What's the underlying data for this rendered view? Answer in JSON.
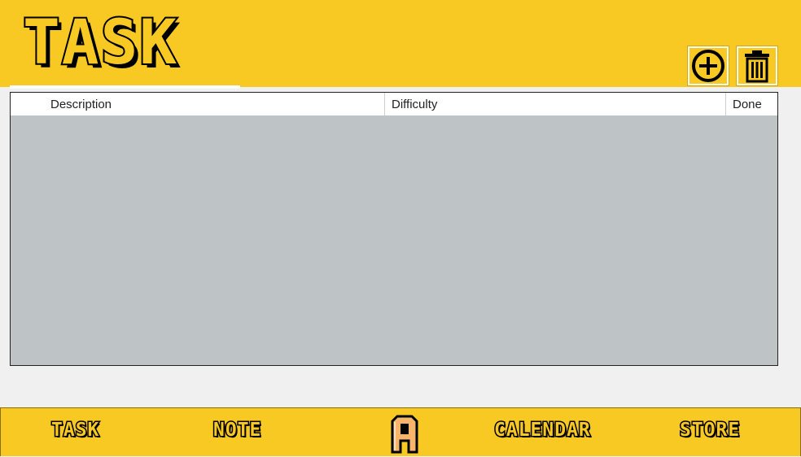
{
  "header": {
    "title": "TASK",
    "add_icon": "plus-circle-icon",
    "delete_icon": "trash-icon"
  },
  "table": {
    "columns": [
      "Description",
      "Difficulty",
      "Done"
    ],
    "rows": []
  },
  "nav": {
    "items": [
      {
        "label": "TASK"
      },
      {
        "label": "NOTE"
      },
      {
        "label": "A",
        "icon": "app-logo-icon"
      },
      {
        "label": "CALENDAR"
      },
      {
        "label": "STORE"
      }
    ]
  },
  "colors": {
    "accent": "#f8c823",
    "table_body": "#bec3c6",
    "background": "#f0f0f0"
  }
}
